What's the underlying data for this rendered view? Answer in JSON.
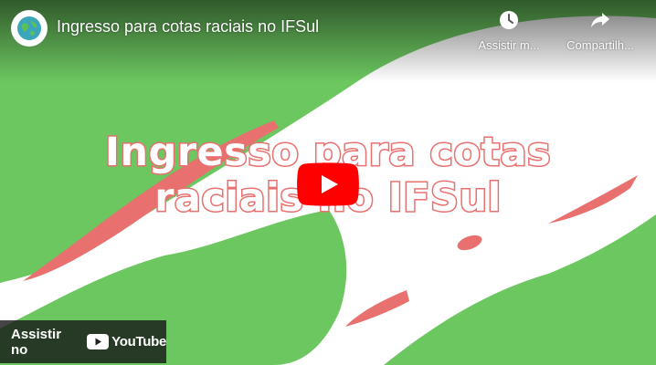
{
  "video": {
    "title": "Ingresso para cotas raciais no IFSul",
    "overlay_line1": "Ingresso para cotas",
    "overlay_line2": "raciais no IFSul"
  },
  "actions": {
    "watch_later_label": "Assistir m...",
    "share_label": "Compartilh..."
  },
  "watch_on": {
    "label": "Assistir no",
    "brand": "YouTube"
  },
  "colors": {
    "green": "#6cc760",
    "coral": "#e8706f",
    "youtube_red": "#ff0000"
  },
  "icons": [
    "channel-avatar-icon",
    "clock-icon",
    "share-arrow-icon",
    "play-icon",
    "youtube-logo-icon"
  ]
}
